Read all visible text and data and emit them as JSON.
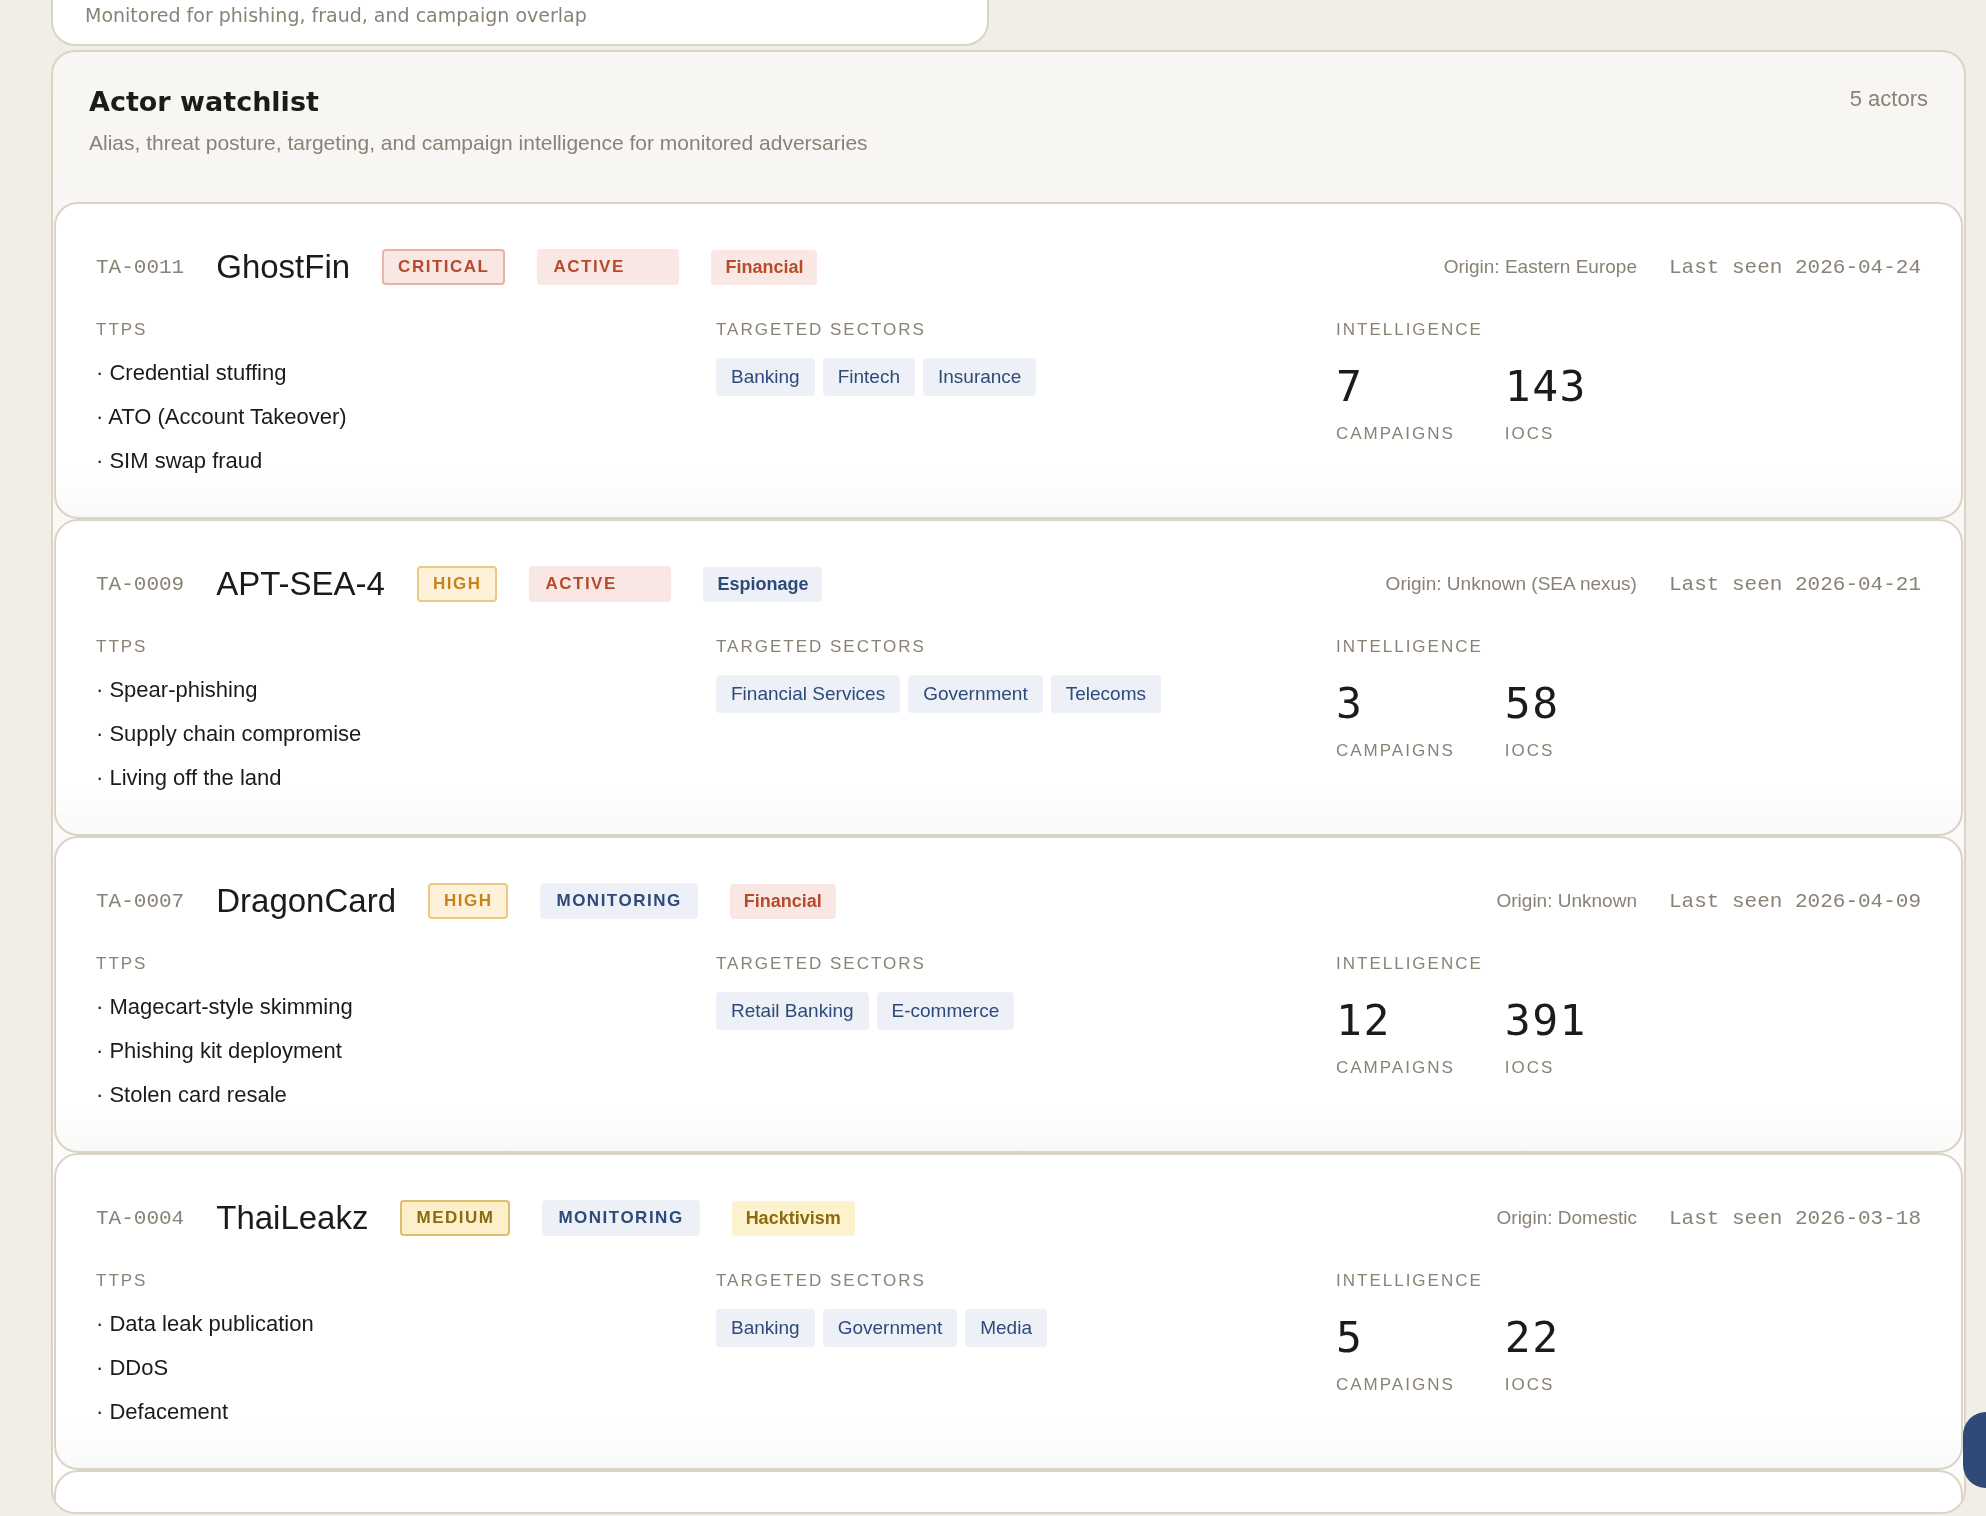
{
  "previous_panel": {
    "subtitle": "Monitored for phishing, fraud, and campaign overlap"
  },
  "watchlist": {
    "title": "Actor watchlist",
    "subtitle": "Alias, threat posture, targeting, and campaign intelligence for monitored adversaries",
    "count": "5 actors",
    "actors": [
      {
        "id": "TA-0011",
        "name": "GhostFin",
        "severity": {
          "label": "CRITICAL",
          "kind": "critical"
        },
        "status": {
          "label": "ACTIVE",
          "kind": "active"
        },
        "category": {
          "label": "Financial",
          "kind": "red"
        },
        "origin": "Origin: Eastern Europe",
        "last_seen": "Last seen 2026-04-24",
        "ttps_label": "TTPS",
        "ttps": [
          "· Credential stuffing",
          "· ATO (Account Takeover)",
          "· SIM swap fraud"
        ],
        "sectors_label": "TARGETED SECTORS",
        "sectors": [
          "Banking",
          "Fintech",
          "Insurance"
        ],
        "intel_label": "INTELLIGENCE",
        "campaigns": "7",
        "campaigns_label": "CAMPAIGNS",
        "iocs": "143",
        "iocs_label": "IOCS"
      },
      {
        "id": "TA-0009",
        "name": "APT-SEA-4",
        "severity": {
          "label": "HIGH",
          "kind": "high"
        },
        "status": {
          "label": "ACTIVE",
          "kind": "active"
        },
        "category": {
          "label": "Espionage",
          "kind": "blue"
        },
        "origin": "Origin: Unknown (SEA nexus)",
        "last_seen": "Last seen 2026-04-21",
        "ttps_label": "TTPS",
        "ttps": [
          "· Spear-phishing",
          "· Supply chain compromise",
          "· Living off the land"
        ],
        "sectors_label": "TARGETED SECTORS",
        "sectors": [
          "Financial Services",
          "Government",
          "Telecoms"
        ],
        "intel_label": "INTELLIGENCE",
        "campaigns": "3",
        "campaigns_label": "CAMPAIGNS",
        "iocs": "58",
        "iocs_label": "IOCS"
      },
      {
        "id": "TA-0007",
        "name": "DragonCard",
        "severity": {
          "label": "HIGH",
          "kind": "high"
        },
        "status": {
          "label": "MONITORING",
          "kind": "monitoring"
        },
        "category": {
          "label": "Financial",
          "kind": "red"
        },
        "origin": "Origin: Unknown",
        "last_seen": "Last seen 2026-04-09",
        "ttps_label": "TTPS",
        "ttps": [
          "· Magecart-style skimming",
          "· Phishing kit deployment",
          "· Stolen card resale"
        ],
        "sectors_label": "TARGETED SECTORS",
        "sectors": [
          "Retail Banking",
          "E-commerce"
        ],
        "intel_label": "INTELLIGENCE",
        "campaigns": "12",
        "campaigns_label": "CAMPAIGNS",
        "iocs": "391",
        "iocs_label": "IOCS"
      },
      {
        "id": "TA-0004",
        "name": "ThaiLeakz",
        "severity": {
          "label": "MEDIUM",
          "kind": "medium"
        },
        "status": {
          "label": "MONITORING",
          "kind": "monitoring"
        },
        "category": {
          "label": "Hacktivism",
          "kind": "yellow"
        },
        "origin": "Origin: Domestic",
        "last_seen": "Last seen 2026-03-18",
        "ttps_label": "TTPS",
        "ttps": [
          "· Data leak publication",
          "· DDoS",
          "· Defacement"
        ],
        "sectors_label": "TARGETED SECTORS",
        "sectors": [
          "Banking",
          "Government",
          "Media"
        ],
        "intel_label": "INTELLIGENCE",
        "campaigns": "5",
        "campaigns_label": "CAMPAIGNS",
        "iocs": "22",
        "iocs_label": "IOCS"
      }
    ]
  }
}
